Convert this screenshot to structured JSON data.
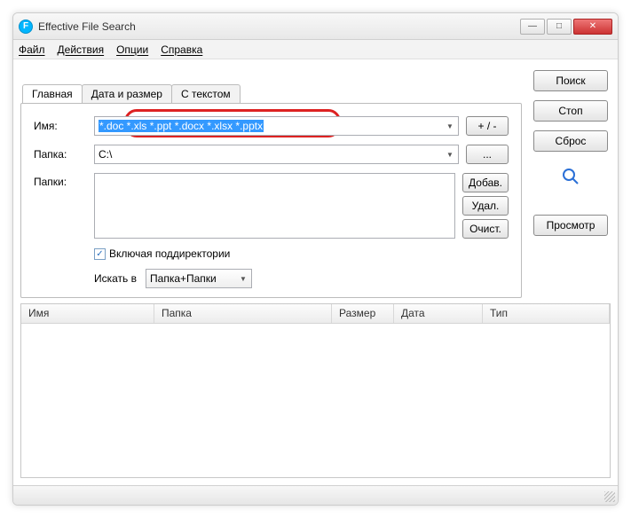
{
  "window": {
    "title": "Effective File Search",
    "icon_letter": "F"
  },
  "menu": {
    "file": "Файл",
    "actions": "Действия",
    "options": "Опции",
    "help": "Справка"
  },
  "tabs": {
    "main": "Главная",
    "date_size": "Дата и размер",
    "with_text": "С текстом"
  },
  "form": {
    "name_label": "Имя:",
    "name_value": "*.doc *.xls *.ppt *.docx *.xlsx *.pptx",
    "folder_label": "Папка:",
    "folder_value": "C:\\",
    "folders_label": "Папки:",
    "plus_minus": "+ / -",
    "browse": "...",
    "add": "Добав.",
    "delete": "Удал.",
    "clear": "Очист.",
    "include_sub": "Включая поддиректории",
    "search_in_label": "Искать в",
    "search_in_value": "Папка+Папки"
  },
  "side": {
    "search": "Поиск",
    "stop": "Стоп",
    "reset": "Сброс",
    "view": "Просмотр"
  },
  "columns": {
    "name": "Имя",
    "folder": "Папка",
    "size": "Размер",
    "date": "Дата",
    "type": "Тип"
  }
}
